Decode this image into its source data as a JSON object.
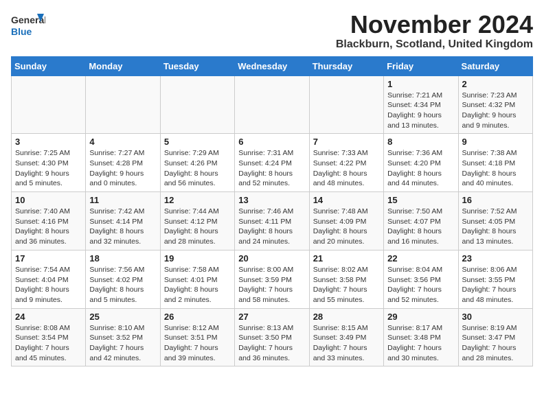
{
  "header": {
    "logo_general": "General",
    "logo_blue": "Blue",
    "month_title": "November 2024",
    "location": "Blackburn, Scotland, United Kingdom"
  },
  "days_of_week": [
    "Sunday",
    "Monday",
    "Tuesday",
    "Wednesday",
    "Thursday",
    "Friday",
    "Saturday"
  ],
  "weeks": [
    [
      {
        "day": "",
        "info": ""
      },
      {
        "day": "",
        "info": ""
      },
      {
        "day": "",
        "info": ""
      },
      {
        "day": "",
        "info": ""
      },
      {
        "day": "",
        "info": ""
      },
      {
        "day": "1",
        "info": "Sunrise: 7:21 AM\nSunset: 4:34 PM\nDaylight: 9 hours and 13 minutes."
      },
      {
        "day": "2",
        "info": "Sunrise: 7:23 AM\nSunset: 4:32 PM\nDaylight: 9 hours and 9 minutes."
      }
    ],
    [
      {
        "day": "3",
        "info": "Sunrise: 7:25 AM\nSunset: 4:30 PM\nDaylight: 9 hours and 5 minutes."
      },
      {
        "day": "4",
        "info": "Sunrise: 7:27 AM\nSunset: 4:28 PM\nDaylight: 9 hours and 0 minutes."
      },
      {
        "day": "5",
        "info": "Sunrise: 7:29 AM\nSunset: 4:26 PM\nDaylight: 8 hours and 56 minutes."
      },
      {
        "day": "6",
        "info": "Sunrise: 7:31 AM\nSunset: 4:24 PM\nDaylight: 8 hours and 52 minutes."
      },
      {
        "day": "7",
        "info": "Sunrise: 7:33 AM\nSunset: 4:22 PM\nDaylight: 8 hours and 48 minutes."
      },
      {
        "day": "8",
        "info": "Sunrise: 7:36 AM\nSunset: 4:20 PM\nDaylight: 8 hours and 44 minutes."
      },
      {
        "day": "9",
        "info": "Sunrise: 7:38 AM\nSunset: 4:18 PM\nDaylight: 8 hours and 40 minutes."
      }
    ],
    [
      {
        "day": "10",
        "info": "Sunrise: 7:40 AM\nSunset: 4:16 PM\nDaylight: 8 hours and 36 minutes."
      },
      {
        "day": "11",
        "info": "Sunrise: 7:42 AM\nSunset: 4:14 PM\nDaylight: 8 hours and 32 minutes."
      },
      {
        "day": "12",
        "info": "Sunrise: 7:44 AM\nSunset: 4:12 PM\nDaylight: 8 hours and 28 minutes."
      },
      {
        "day": "13",
        "info": "Sunrise: 7:46 AM\nSunset: 4:11 PM\nDaylight: 8 hours and 24 minutes."
      },
      {
        "day": "14",
        "info": "Sunrise: 7:48 AM\nSunset: 4:09 PM\nDaylight: 8 hours and 20 minutes."
      },
      {
        "day": "15",
        "info": "Sunrise: 7:50 AM\nSunset: 4:07 PM\nDaylight: 8 hours and 16 minutes."
      },
      {
        "day": "16",
        "info": "Sunrise: 7:52 AM\nSunset: 4:05 PM\nDaylight: 8 hours and 13 minutes."
      }
    ],
    [
      {
        "day": "17",
        "info": "Sunrise: 7:54 AM\nSunset: 4:04 PM\nDaylight: 8 hours and 9 minutes."
      },
      {
        "day": "18",
        "info": "Sunrise: 7:56 AM\nSunset: 4:02 PM\nDaylight: 8 hours and 5 minutes."
      },
      {
        "day": "19",
        "info": "Sunrise: 7:58 AM\nSunset: 4:01 PM\nDaylight: 8 hours and 2 minutes."
      },
      {
        "day": "20",
        "info": "Sunrise: 8:00 AM\nSunset: 3:59 PM\nDaylight: 7 hours and 58 minutes."
      },
      {
        "day": "21",
        "info": "Sunrise: 8:02 AM\nSunset: 3:58 PM\nDaylight: 7 hours and 55 minutes."
      },
      {
        "day": "22",
        "info": "Sunrise: 8:04 AM\nSunset: 3:56 PM\nDaylight: 7 hours and 52 minutes."
      },
      {
        "day": "23",
        "info": "Sunrise: 8:06 AM\nSunset: 3:55 PM\nDaylight: 7 hours and 48 minutes."
      }
    ],
    [
      {
        "day": "24",
        "info": "Sunrise: 8:08 AM\nSunset: 3:54 PM\nDaylight: 7 hours and 45 minutes."
      },
      {
        "day": "25",
        "info": "Sunrise: 8:10 AM\nSunset: 3:52 PM\nDaylight: 7 hours and 42 minutes."
      },
      {
        "day": "26",
        "info": "Sunrise: 8:12 AM\nSunset: 3:51 PM\nDaylight: 7 hours and 39 minutes."
      },
      {
        "day": "27",
        "info": "Sunrise: 8:13 AM\nSunset: 3:50 PM\nDaylight: 7 hours and 36 minutes."
      },
      {
        "day": "28",
        "info": "Sunrise: 8:15 AM\nSunset: 3:49 PM\nDaylight: 7 hours and 33 minutes."
      },
      {
        "day": "29",
        "info": "Sunrise: 8:17 AM\nSunset: 3:48 PM\nDaylight: 7 hours and 30 minutes."
      },
      {
        "day": "30",
        "info": "Sunrise: 8:19 AM\nSunset: 3:47 PM\nDaylight: 7 hours and 28 minutes."
      }
    ]
  ]
}
